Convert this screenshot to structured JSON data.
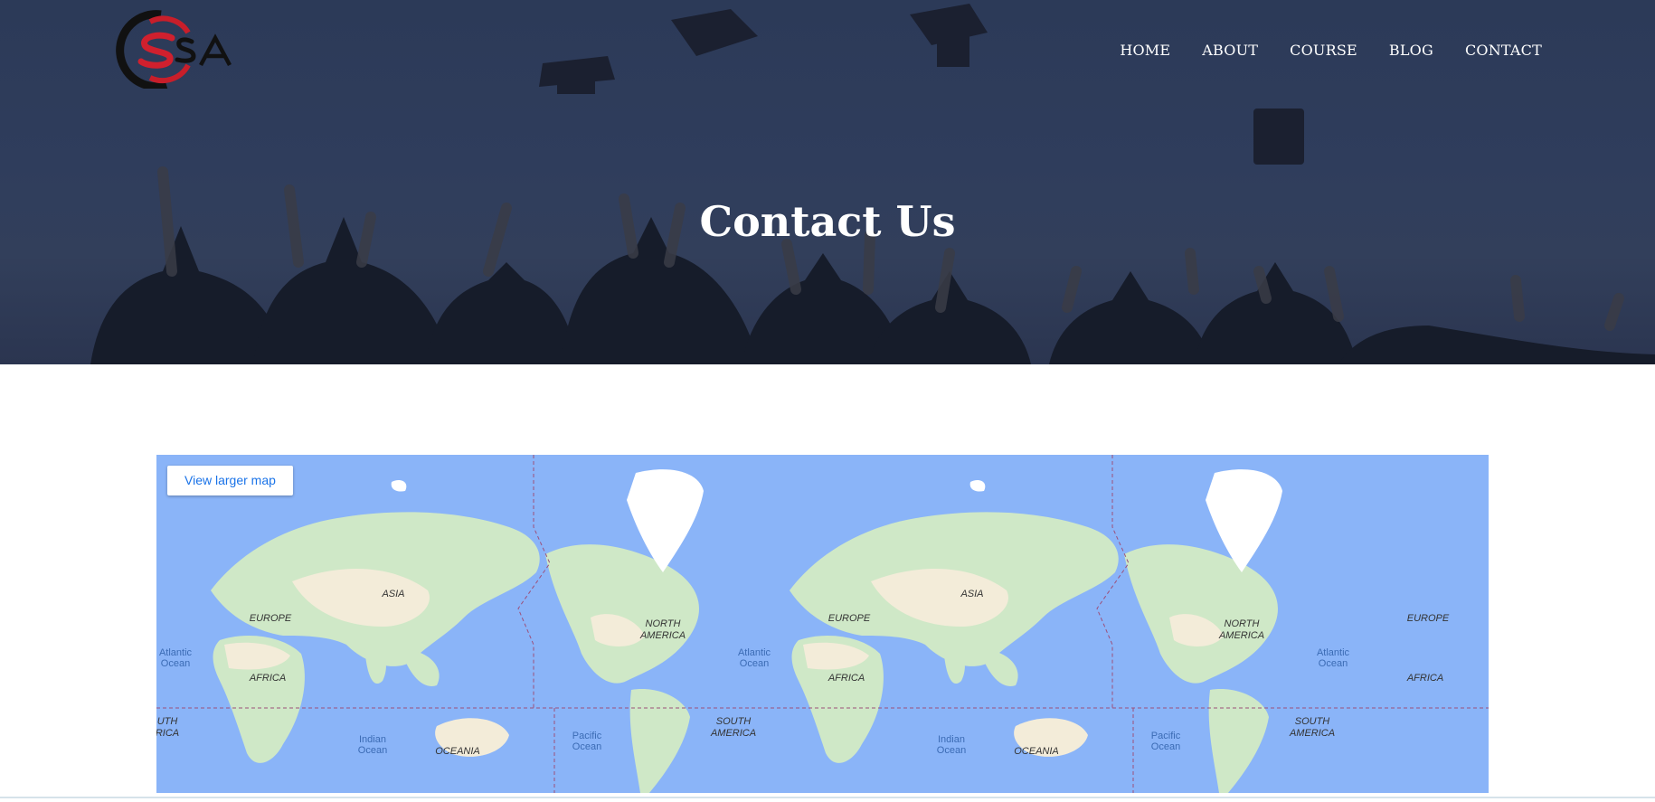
{
  "brand": {
    "logo_text": "SSA",
    "accent_color": "#d0202e"
  },
  "nav": {
    "items": [
      {
        "label": "HOME"
      },
      {
        "label": "ABOUT"
      },
      {
        "label": "COURSE"
      },
      {
        "label": "BLOG"
      },
      {
        "label": "CONTACT"
      }
    ]
  },
  "hero": {
    "title": "Contact Us"
  },
  "map": {
    "view_larger_label": "View larger map",
    "labels": {
      "asia": "ASIA",
      "europe": "EUROPE",
      "africa": "AFRICA",
      "north_america": [
        "NORTH",
        "AMERICA"
      ],
      "south_america": [
        "SOUTH",
        "AMERICA"
      ],
      "oceania": "OCEANIA",
      "atlantic": [
        "Atlantic",
        "Ocean"
      ],
      "indian": [
        "Indian",
        "Ocean"
      ],
      "pacific": [
        "Pacific",
        "Ocean"
      ],
      "partial_south_america": [
        "UTH",
        "RICA"
      ]
    },
    "colors": {
      "ocean": "#8ab4f8",
      "land": "#cfe8c7",
      "ice": "#ffffff",
      "desert": "#f3ecd9"
    }
  }
}
